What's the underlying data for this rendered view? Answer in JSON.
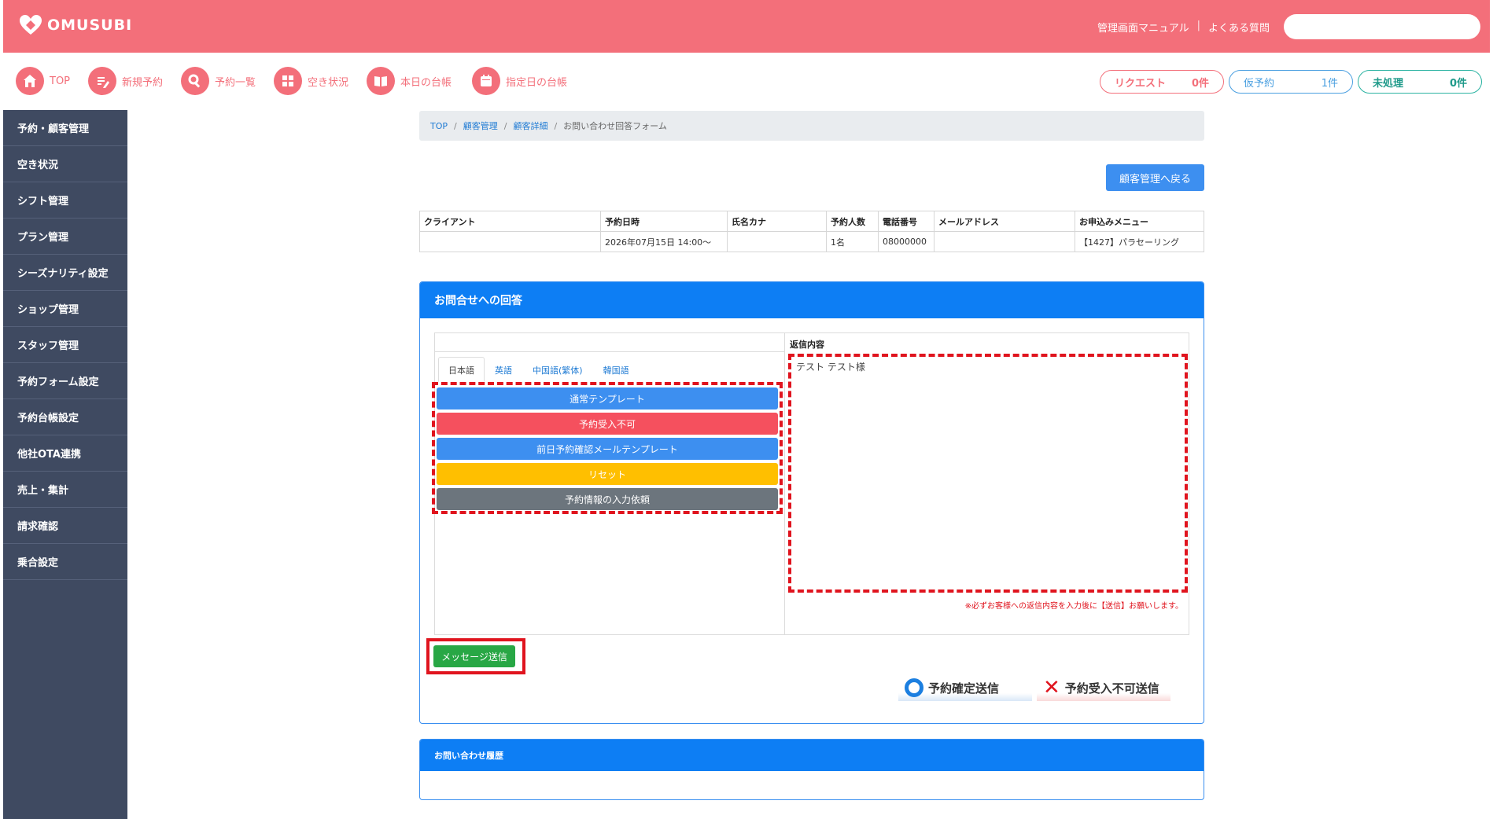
{
  "header": {
    "brand": "OMUSUBI",
    "links": [
      "管理画面マニュアル",
      "よくある質問"
    ],
    "search_placeholder": ""
  },
  "nav": {
    "items": [
      {
        "label": "TOP",
        "icon": "home-icon"
      },
      {
        "label": "新規予約",
        "icon": "edit-icon"
      },
      {
        "label": "予約一覧",
        "icon": "search-icon"
      },
      {
        "label": "空き状況",
        "icon": "grid-icon"
      },
      {
        "label": "本日の台帳",
        "icon": "book-icon"
      },
      {
        "label": "指定日の台帳",
        "icon": "calendar-icon"
      }
    ],
    "counters": [
      {
        "label": "リクエスト",
        "count": "0件"
      },
      {
        "label": "仮予約",
        "count": "1件"
      },
      {
        "label": "未処理",
        "count": "0件"
      }
    ]
  },
  "sidebar": {
    "items": [
      "予約・顧客管理",
      "空き状況",
      "シフト管理",
      "プラン管理",
      "シーズナリティ設定",
      "ショップ管理",
      "スタッフ管理",
      "予約フォーム設定",
      "予約台帳設定",
      "他社OTA連携",
      "売上・集計",
      "請求確認",
      "乗合設定"
    ]
  },
  "breadcrumb": [
    "TOP",
    "顧客管理",
    "顧客詳細",
    "お問い合わせ回答フォーム"
  ],
  "back_button": "顧客管理へ戻る",
  "info_table": {
    "headers": [
      "クライアント",
      "予約日時",
      "氏名カナ",
      "予約人数",
      "電話番号",
      "メールアドレス",
      "お申込みメニュー"
    ],
    "row": [
      "",
      "2026年07月15日 14:00〜",
      "",
      "1名",
      "08000000",
      "",
      "【1427】パラセーリング"
    ]
  },
  "reply_panel": {
    "title": "お問合せへの回答",
    "tabs": [
      "日本語",
      "英語",
      "中国語(繁体)",
      "韓国語"
    ],
    "templates": [
      "通常テンプレート",
      "予約受入不可",
      "前日予約確認メールテンプレート",
      "リセット",
      "予約情報の入力依頼"
    ],
    "reply_label": "返信内容",
    "reply_text": "テスト テスト様",
    "note": "※必ずお客様への返信内容を入力後に【送信】お願いします。",
    "send_button": "メッセージ送信",
    "confirm_button": "予約確定送信",
    "reject_button": "予約受入不可送信"
  },
  "history_panel": {
    "title": "お問い合わせ履歴"
  },
  "colors": {
    "brand": "#f36f7a",
    "sidebar": "#3f4a61",
    "primary": "#0d7ef4",
    "highlight": "#e0141e"
  }
}
